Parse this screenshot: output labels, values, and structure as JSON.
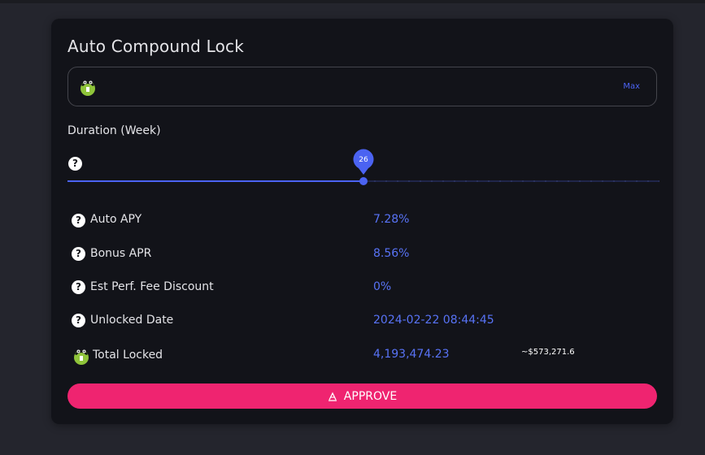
{
  "card": {
    "title": "Auto Compound Lock"
  },
  "amount": {
    "value": "",
    "placeholder": "",
    "max_label": "Max",
    "token_icon": "token-logo-icon"
  },
  "duration": {
    "label": "Duration (Week)",
    "value": "26",
    "min": 0,
    "max": 52
  },
  "stats": [
    {
      "label": "Auto APY",
      "value": "7.28%"
    },
    {
      "label": "Bonus APR",
      "value": "8.56%"
    },
    {
      "label": "Est Perf. Fee Discount",
      "value": "0%"
    },
    {
      "label": "Unlocked Date",
      "value": "2024-02-22 08:44:45"
    },
    {
      "label": "Total Locked",
      "value": "4,193,474.23",
      "usd": "~$573,271.6"
    }
  ],
  "approve": {
    "label": "APPROVE"
  },
  "colors": {
    "accent": "#5873f6",
    "slider": "#4b63f2",
    "button": "#ef2470",
    "card": "#121319",
    "background": "#24252d"
  }
}
